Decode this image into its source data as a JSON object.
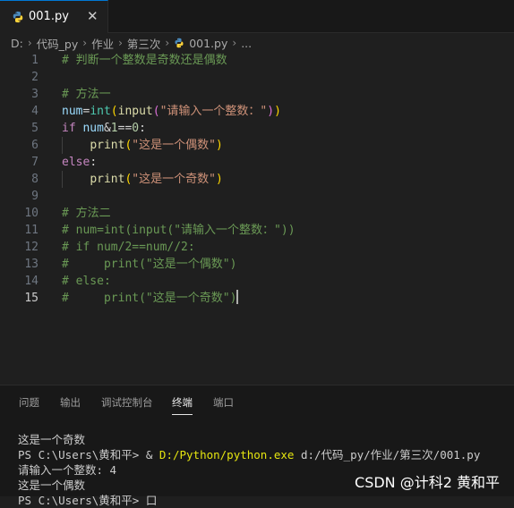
{
  "tab": {
    "filename": "001.py",
    "close_glyph": "✕",
    "icon": "python-icon"
  },
  "breadcrumb": {
    "parts": [
      "D:",
      "代码_py",
      "作业",
      "第三次"
    ],
    "file": "001.py",
    "more": "...",
    "separator": "›"
  },
  "editor": {
    "active_line": 15,
    "line_numbers": [
      "1",
      "2",
      "3",
      "4",
      "5",
      "6",
      "7",
      "8",
      "9",
      "10",
      "11",
      "12",
      "13",
      "14",
      "15"
    ],
    "tokens": {
      "l1": "# 判断一个整数是奇数还是偶数",
      "l3": "# 方法一",
      "l4_var": "num",
      "l4_eq": "=",
      "l4_int": "int",
      "l4_p1o": "(",
      "l4_input": "input",
      "l4_p2o": "(",
      "l4_str": "\"请输入一个整数：\"",
      "l4_p2c": ")",
      "l4_p1c": ")",
      "l5_if": "if",
      "l5_var": "num",
      "l5_op": "&",
      "l5_n1": "1",
      "l5_eqeq": "==",
      "l5_n0": "0",
      "l5_colon": ":",
      "l6_print": "print",
      "l6_po": "(",
      "l6_str": "\"这是一个偶数\"",
      "l6_pc": ")",
      "l7_else": "else",
      "l7_colon": ":",
      "l8_print": "print",
      "l8_po": "(",
      "l8_str": "\"这是一个奇数\"",
      "l8_pc": ")",
      "l10": "# 方法二",
      "l11": "# num=int(input(\"请输入一个整数：\"))",
      "l12": "# if num/2==num//2:",
      "l13": "#     print(\"这是一个偶数\")",
      "l14": "# else:",
      "l15": "#     print(\"这是一个奇数\")"
    }
  },
  "panel": {
    "tabs": [
      "问题",
      "输出",
      "调试控制台",
      "终端",
      "端口"
    ],
    "active_tab": "终端",
    "terminal": {
      "line1": "这是一个奇数",
      "line2_prompt": "PS C:\\Users\\黄和平> & ",
      "line2_exe": "D:/Python/python.exe",
      "line2_arg": " d:/代码_py/作业/第三次/001.py",
      "line3": "请输入一个整数: 4",
      "line4": "这是一个偶数",
      "line5": "PS C:\\Users\\黄和平> ",
      "line5_tail": "口"
    }
  },
  "watermark": "CSDN @计科2 黄和平",
  "colors": {
    "editor_bg": "#1f1f1f",
    "panel_bg": "#181818",
    "comment": "#6a9955",
    "keyword": "#c586c0",
    "function": "#dcdcaa",
    "builtin": "#4ec9b0",
    "string": "#ce9178",
    "variable": "#9cdcfe",
    "number": "#b5cea8",
    "accent": "#0078d4"
  }
}
